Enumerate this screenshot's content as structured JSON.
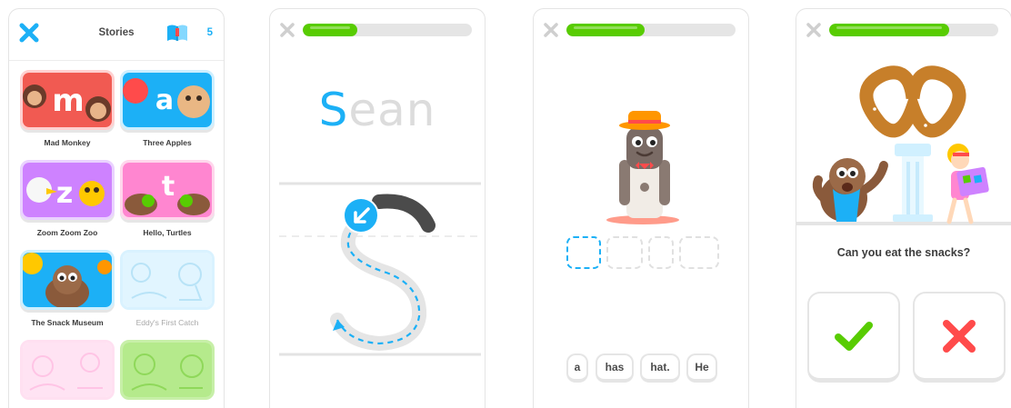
{
  "stories_screen": {
    "title": "Stories",
    "count": "5",
    "icons": {
      "close": "close-icon",
      "book": "book-icon"
    },
    "stories": [
      {
        "title": "Mad Monkey",
        "thumb_letter": "m",
        "locked": false
      },
      {
        "title": "Three Apples",
        "thumb_letter": "a",
        "locked": false
      },
      {
        "title": "Zoom Zoom Zoo",
        "thumb_letter": "z",
        "locked": false
      },
      {
        "title": "Hello, Turtles",
        "thumb_letter": "t",
        "locked": false
      },
      {
        "title": "The Snack Museum",
        "locked": false
      },
      {
        "title": "Eddy's First Catch",
        "locked": true
      },
      {
        "locked": true
      },
      {
        "locked": true
      }
    ]
  },
  "tracing_screen": {
    "progress": 0.32,
    "word_first_letter": "S",
    "word_rest": "ean"
  },
  "word_bank_screen": {
    "progress": 0.46,
    "answer_blanks": 4,
    "tiles": [
      "a",
      "has",
      "hat.",
      "He"
    ]
  },
  "question_screen": {
    "progress": 0.71,
    "question": "Can you eat the snacks?",
    "answers": [
      "yes",
      "no"
    ]
  },
  "colors": {
    "accent_blue": "#1cb0f6",
    "progress_green": "#58cc02",
    "wrong_red": "#ff4b4b",
    "border_gray": "#e5e5e5"
  }
}
